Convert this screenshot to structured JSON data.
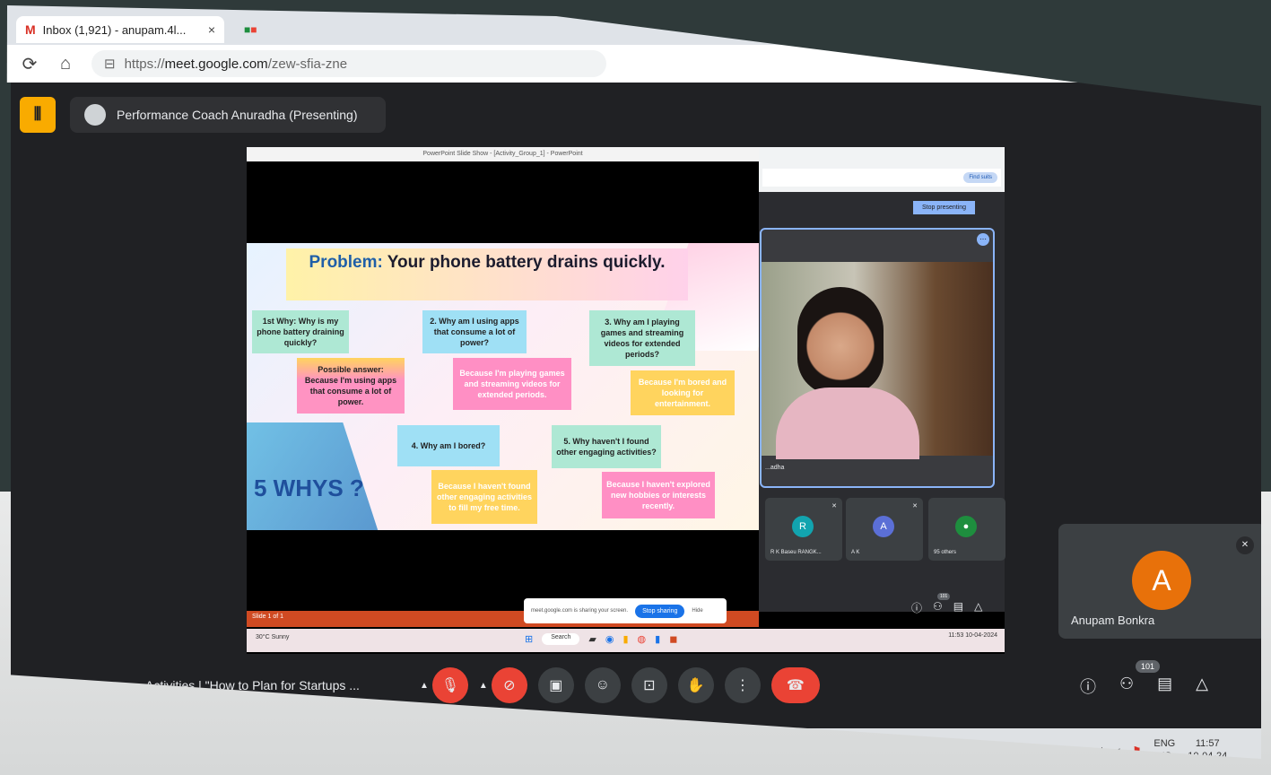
{
  "browser": {
    "tab_title": "Inbox (1,921) - anupam.4l...",
    "tab_close": "×",
    "url_prefix": "https://",
    "url_host": "meet.google.com",
    "url_path": "/zew-sfia-zne"
  },
  "meet": {
    "presenter_label": "Performance Coach Anuradha (Presenting)",
    "meeting_title": "Activities | \"How to Plan for Startups ...",
    "participant_count": "101",
    "inner_participant_count": "101",
    "self_tile": {
      "initial": "A",
      "name": "Anupam Bonkra"
    }
  },
  "shared_screen": {
    "pp_titlebar": "PowerPoint Slide Show - [Activity_Group_1] - PowerPoint",
    "stop_presenting": "Stop presenting",
    "share_notice_text": "meet.google.com is sharing your screen.",
    "stop_sharing": "Stop sharing",
    "hide": "Hide",
    "find_button": "Find suits",
    "pp_status": "Slide 1 of 1",
    "speaker_name": "...adha",
    "mini_tiles": [
      {
        "initial": "R",
        "name": "R K Baseu RANGK...",
        "color": "#12a4af"
      },
      {
        "initial": "A",
        "name": "A K",
        "color": "#5b6fd6"
      },
      {
        "initial": "",
        "name": "95 others",
        "color": "#1e8e3e"
      }
    ],
    "taskbar": {
      "weather": "30°C Sunny",
      "search": "Search",
      "clock": "11:53 10-04-2024"
    }
  },
  "slide": {
    "title_lead": "Problem:",
    "title_rest": "Your phone battery drains quickly.",
    "q1": "1st Why: Why is my phone battery draining quickly?",
    "a1": "Possible answer: Because I'm using apps that consume a lot of power.",
    "q2": "2. Why am I using apps that consume a lot of power?",
    "a2": "Because I'm playing games and streaming videos for extended periods.",
    "q3": "3. Why am I playing games and streaming videos for extended periods?",
    "a3": "Because I'm bored and looking for entertainment.",
    "q4": "4. Why am I bored?",
    "a4": "Because I haven't found other engaging activities to fill my free time.",
    "q5": "5. Why haven't I found other engaging activities?",
    "a5": "Because I haven't explored new hobbies or interests recently.",
    "whys": "5 WHYS ?"
  },
  "os_taskbar": {
    "lang_top": "ENG",
    "lang_bottom": "US",
    "time": "11:57",
    "date": "10-04-24"
  },
  "icons": [
    "reload-icon",
    "home-icon",
    "site-info-icon",
    "mic-off-icon",
    "camera-off-icon",
    "captions-icon",
    "emoji-icon",
    "present-icon",
    "raise-hand-icon",
    "more-icon",
    "hang-up-icon",
    "info-icon",
    "people-icon",
    "chat-icon",
    "activities-icon"
  ]
}
